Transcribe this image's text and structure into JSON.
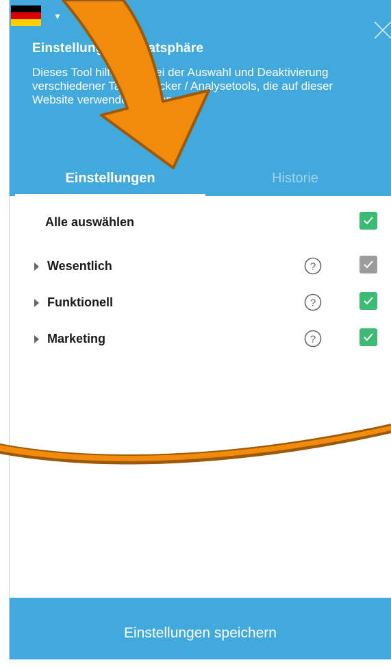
{
  "header": {
    "language_flag_icon": "german-flag-icon",
    "caret": "▼",
    "title": "Einstellungen Privatsphäre",
    "description": "Dieses Tool hilft Ihnen bei der Auswahl und Deaktivierung verschiedener Tags / Tracker / Analysetools, die auf dieser Website verwendet werden."
  },
  "tabs": [
    {
      "label": "Einstellungen",
      "active": true
    },
    {
      "label": "Historie",
      "active": false
    }
  ],
  "select_all": {
    "label": "Alle auswählen",
    "checked": true
  },
  "categories": [
    {
      "label": "Wesentlich",
      "checked": true,
      "locked": true
    },
    {
      "label": "Funktionell",
      "checked": true,
      "locked": false
    },
    {
      "label": "Marketing",
      "checked": true,
      "locked": false
    }
  ],
  "footer": {
    "save_label": "Einstellungen speichern"
  },
  "colors": {
    "header_bg": "#42a9dc",
    "checkbox_green": "#3dba74",
    "checkbox_gray": "#9c9c9c",
    "annotation_orange": "#f28a0c"
  }
}
